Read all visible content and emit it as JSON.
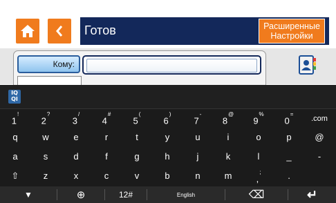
{
  "header": {
    "status_title": "Готов",
    "advanced_label_line1": "Расширенные",
    "advanced_label_line2": "Настройки"
  },
  "form": {
    "to_label": "Кому:",
    "to_value": ""
  },
  "keyboard": {
    "logo": "IQ QI",
    "rows": [
      [
        {
          "main": "1",
          "alt": "!"
        },
        {
          "main": "2",
          "alt": "?"
        },
        {
          "main": "3",
          "alt": "/"
        },
        {
          "main": "4",
          "alt": "#"
        },
        {
          "main": "5",
          "alt": "("
        },
        {
          "main": "6",
          "alt": ")"
        },
        {
          "main": "7",
          "alt": "-"
        },
        {
          "main": "8",
          "alt": "@"
        },
        {
          "main": "9",
          "alt": "%"
        },
        {
          "main": "0",
          "alt": "="
        },
        {
          "main": ".com",
          "alt": ""
        }
      ],
      [
        {
          "main": "q",
          "alt": ""
        },
        {
          "main": "w",
          "alt": ""
        },
        {
          "main": "e",
          "alt": ""
        },
        {
          "main": "r",
          "alt": ""
        },
        {
          "main": "t",
          "alt": ""
        },
        {
          "main": "y",
          "alt": ""
        },
        {
          "main": "u",
          "alt": ""
        },
        {
          "main": "i",
          "alt": ""
        },
        {
          "main": "o",
          "alt": ""
        },
        {
          "main": "p",
          "alt": ""
        },
        {
          "main": "@",
          "alt": ""
        }
      ],
      [
        {
          "main": "a",
          "alt": ""
        },
        {
          "main": "s",
          "alt": ""
        },
        {
          "main": "d",
          "alt": ""
        },
        {
          "main": "f",
          "alt": ""
        },
        {
          "main": "g",
          "alt": ""
        },
        {
          "main": "h",
          "alt": ""
        },
        {
          "main": "j",
          "alt": ""
        },
        {
          "main": "k",
          "alt": ""
        },
        {
          "main": "l",
          "alt": ""
        },
        {
          "main": "_",
          "alt": ""
        },
        {
          "main": "-",
          "alt": ""
        }
      ],
      [
        {
          "main": "⇧",
          "alt": ""
        },
        {
          "main": "z",
          "alt": ""
        },
        {
          "main": "x",
          "alt": ""
        },
        {
          "main": "c",
          "alt": ""
        },
        {
          "main": "v",
          "alt": ""
        },
        {
          "main": "b",
          "alt": ""
        },
        {
          "main": "n",
          "alt": ""
        },
        {
          "main": "m",
          "alt": ""
        },
        {
          "main": ",",
          "alt": ";"
        },
        {
          "main": ".",
          "alt": ""
        }
      ]
    ],
    "bottom": {
      "hide_glyph": "▼",
      "globe_glyph": "⊕",
      "sym_label": "12#",
      "space_label": "English",
      "backspace_glyph": "⌫",
      "enter_glyph": "↵"
    }
  },
  "colors": {
    "accent_orange": "#f07b1d",
    "title_navy": "#13285a",
    "keyboard_bg": "#1b1b1b"
  },
  "icons": {
    "home": "home-icon",
    "back": "chevron-left-icon",
    "menu": "kebab-menu-icon",
    "contacts": "address-book-icon"
  }
}
